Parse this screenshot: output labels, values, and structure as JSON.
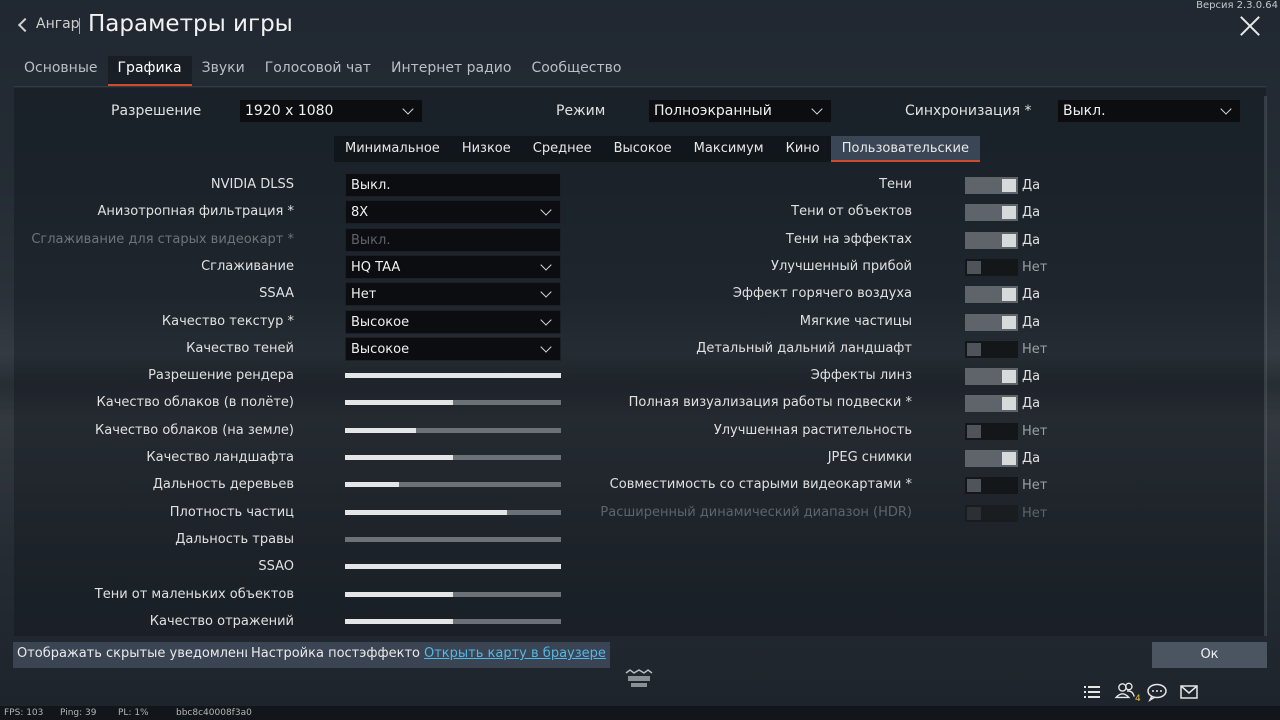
{
  "header": {
    "version": "Версия 2.3.0.64",
    "back_label": "Ангар",
    "title": "Параметры игры"
  },
  "tabs": [
    "Основные",
    "Графика",
    "Звуки",
    "Голосовой чат",
    "Интернет радио",
    "Сообщество"
  ],
  "active_tab": "Графика",
  "top_row": {
    "resolution_label": "Разрешение",
    "resolution_value": "1920 x 1080",
    "mode_label": "Режим",
    "mode_value": "Полноэкранный",
    "vsync_label": "Синхронизация *",
    "vsync_value": "Выкл."
  },
  "presets": [
    "Минимальное",
    "Низкое",
    "Среднее",
    "Высокое",
    "Максимум",
    "Кино",
    "Пользовательские"
  ],
  "active_preset": "Пользовательские",
  "left_settings": [
    {
      "label": "NVIDIA DLSS",
      "type": "field",
      "value": "Выкл.",
      "disabled": false
    },
    {
      "label": "Анизотропная фильтрация *",
      "type": "select",
      "value": "8X",
      "disabled": false
    },
    {
      "label": "Сглаживание для старых видеокарт *",
      "type": "field",
      "value": "Выкл.",
      "disabled": true
    },
    {
      "label": "Сглаживание",
      "type": "select",
      "value": "HQ TAA",
      "disabled": false
    },
    {
      "label": "SSAA",
      "type": "select",
      "value": "Нет",
      "disabled": false
    },
    {
      "label": "Качество текстур *",
      "type": "select",
      "value": "Высокое",
      "disabled": false
    },
    {
      "label": "Качество теней",
      "type": "select",
      "value": "Высокое",
      "disabled": false
    },
    {
      "label": "Разрешение рендера",
      "type": "slider",
      "level": 1.0
    },
    {
      "label": "Качество облаков (в полёте)",
      "type": "slider",
      "level": 0.5
    },
    {
      "label": "Качество облаков (на земле)",
      "type": "slider",
      "level": 0.33
    },
    {
      "label": "Качество ландшафта",
      "type": "slider",
      "level": 0.5
    },
    {
      "label": "Дальность деревьев",
      "type": "slider",
      "level": 0.25
    },
    {
      "label": "Плотность частиц",
      "type": "slider",
      "level": 0.75
    },
    {
      "label": "Дальность травы",
      "type": "slider",
      "level": 0.0
    },
    {
      "label": "SSAO",
      "type": "slider",
      "level": 1.0
    },
    {
      "label": "Тени от маленьких объектов",
      "type": "slider",
      "level": 0.5
    },
    {
      "label": "Качество отражений",
      "type": "slider",
      "level": 0.5
    }
  ],
  "right_settings": [
    {
      "label": "Тени",
      "on": true,
      "value": "Да",
      "disabled": false
    },
    {
      "label": "Тени от объектов",
      "on": true,
      "value": "Да",
      "disabled": false
    },
    {
      "label": "Тени на эффектах",
      "on": true,
      "value": "Да",
      "disabled": false
    },
    {
      "label": "Улучшенный прибой",
      "on": false,
      "value": "Нет",
      "disabled": false
    },
    {
      "label": "Эффект горячего воздуха",
      "on": true,
      "value": "Да",
      "disabled": false
    },
    {
      "label": "Мягкие частицы",
      "on": true,
      "value": "Да",
      "disabled": false
    },
    {
      "label": "Детальный дальний ландшафт",
      "on": false,
      "value": "Нет",
      "disabled": false
    },
    {
      "label": "Эффекты линз",
      "on": true,
      "value": "Да",
      "disabled": false
    },
    {
      "label": "Полная визуализация работы подвески *",
      "on": true,
      "value": "Да",
      "disabled": false
    },
    {
      "label": "Улучшенная растительность",
      "on": false,
      "value": "Нет",
      "disabled": false
    },
    {
      "label": "JPEG снимки",
      "on": true,
      "value": "Да",
      "disabled": false
    },
    {
      "label": "Совместимость со старыми видеокартами *",
      "on": false,
      "value": "Нет",
      "disabled": false
    },
    {
      "label": "Расширенный динамический диапазон (HDR)",
      "on": false,
      "value": "Нет",
      "disabled": true
    }
  ],
  "bottom": {
    "show_hidden_label": "Отображать скрытые уведомления",
    "postfx_label": "Настройка постэффектов",
    "open_map_label": "Открыть карту в браузере",
    "ok_label": "Ок",
    "logo_text": "WAR THUNDER",
    "squad_count": "4"
  },
  "status": {
    "fps": "FPS: 103",
    "ping": "Ping: 39",
    "pl": "PL: 1%",
    "session": "bbc8c40008f3a0"
  },
  "icons": [
    "list-icon",
    "squad-icon",
    "chat-icon",
    "mail-icon"
  ]
}
